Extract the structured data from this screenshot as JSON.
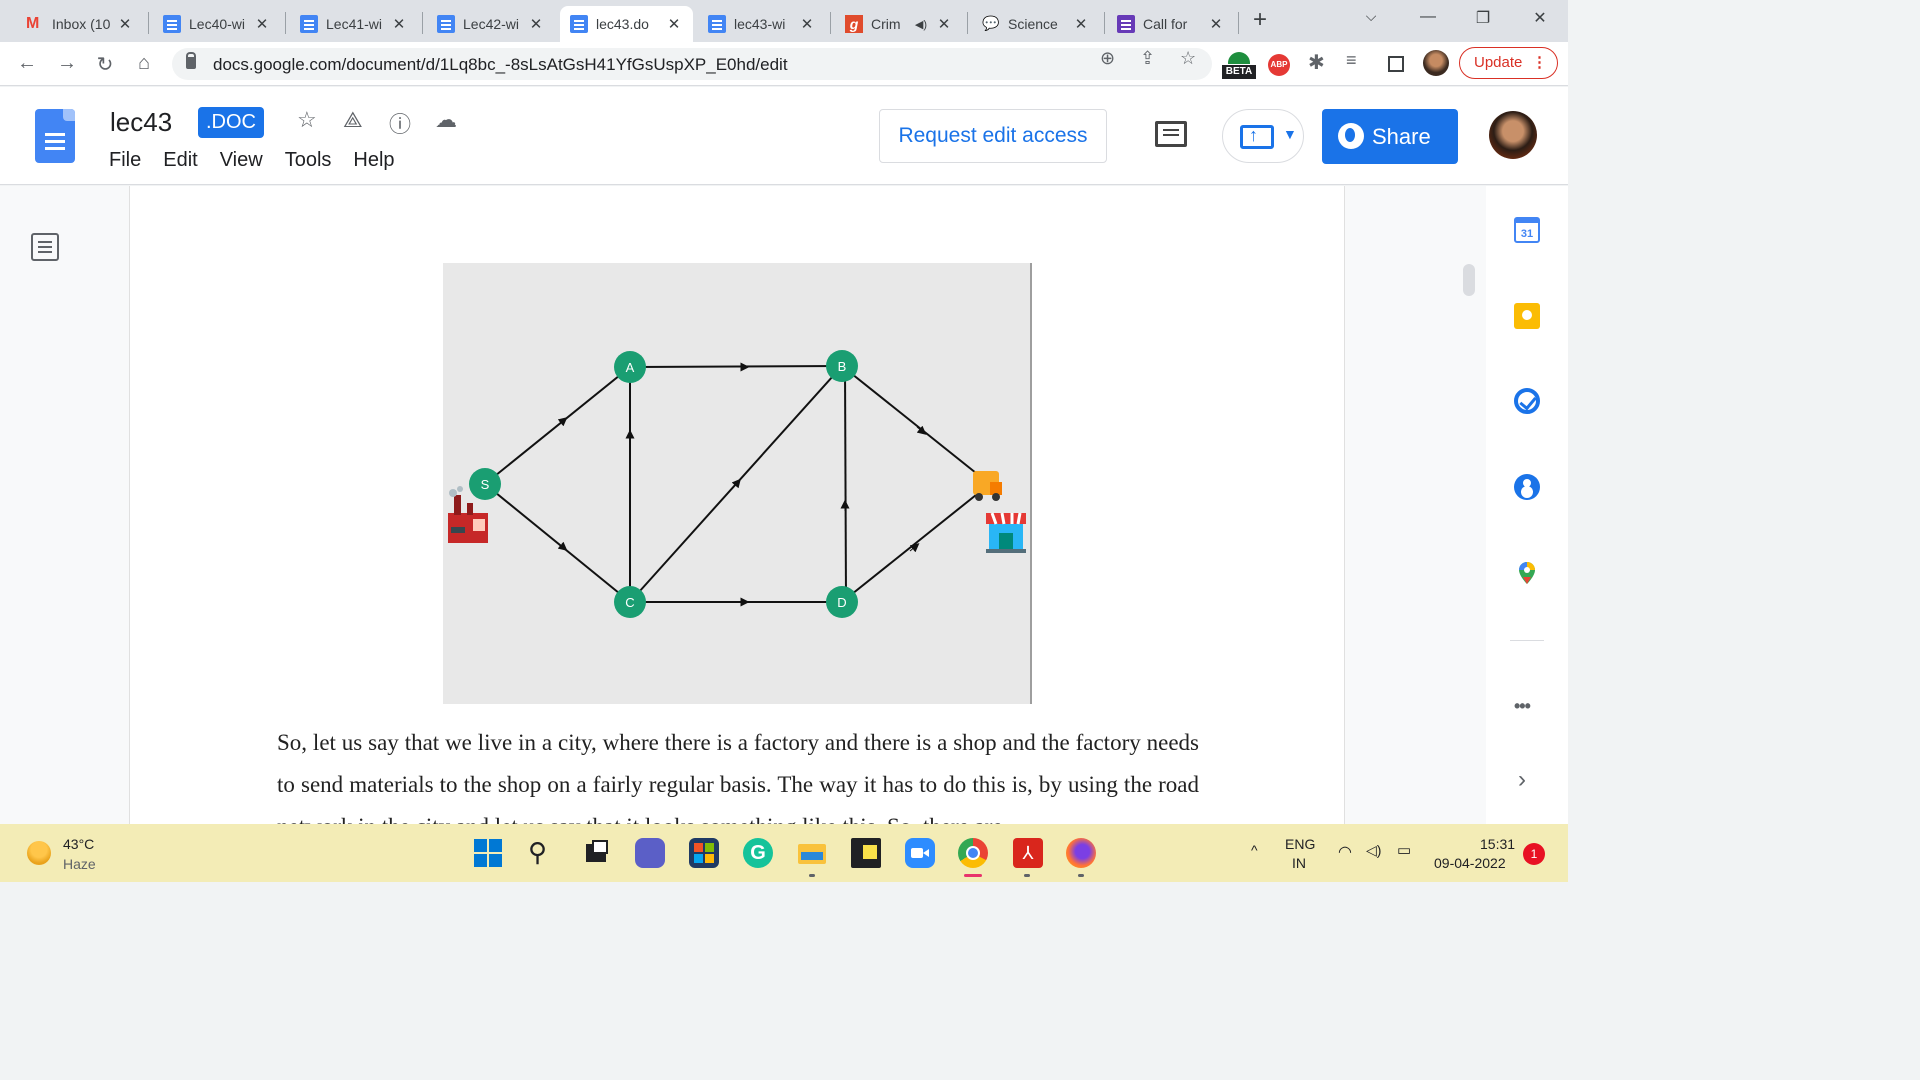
{
  "browser": {
    "tabs": [
      {
        "label": "Inbox (10",
        "icon": "gmail-icon",
        "active": false
      },
      {
        "label": "Lec40-wi",
        "icon": "google-docs-icon",
        "active": false
      },
      {
        "label": "Lec41-wi",
        "icon": "google-docs-icon",
        "active": false
      },
      {
        "label": "Lec42-wi",
        "icon": "google-docs-icon",
        "active": false
      },
      {
        "label": "lec43.do",
        "icon": "google-docs-icon",
        "active": true
      },
      {
        "label": "lec43-wi",
        "icon": "google-docs-icon",
        "active": false
      },
      {
        "label": "Crim",
        "icon": "grammarly-icon",
        "active": false,
        "audio": true
      },
      {
        "label": "Science",
        "icon": "speech-bubble-icon",
        "active": false
      },
      {
        "label": "Call for",
        "icon": "google-forms-icon",
        "active": false
      }
    ],
    "new_tab_glyph": "+",
    "url": "docs.google.com/document/d/1Lq8bc_-8sLsAtGsH41YfGsUspXP_E0hd/edit",
    "beta_label": "BETA",
    "abp_label": "ABP",
    "update_label": "Update",
    "close_glyph": "✕"
  },
  "doc": {
    "title": "lec43",
    "badge": ".DOC",
    "menu": [
      "File",
      "Edit",
      "View",
      "Tools",
      "Help"
    ],
    "request_edit": "Request edit access",
    "share": "Share",
    "paragraph": "So, let us say that we live in a city, where there is a factory and there is a shop and the factory needs to send materials to the shop on a fairly regular basis. The way it has to do this is, by using the road network in the city and let us say that it looks something like this. So, there are"
  },
  "diagram": {
    "background": "#e8e8e8",
    "node_color": "#1a9e72",
    "nodes": [
      "S",
      "A",
      "B",
      "C",
      "D"
    ],
    "edges": [
      [
        "S",
        "A"
      ],
      [
        "S",
        "C"
      ],
      [
        "A",
        "B"
      ],
      [
        "C",
        "A"
      ],
      [
        "C",
        "B"
      ],
      [
        "C",
        "D"
      ],
      [
        "D",
        "B"
      ],
      [
        "B",
        "T"
      ],
      [
        "D",
        "T"
      ]
    ]
  },
  "side_panel": {
    "calendar_day": "31",
    "more_glyph": "•••",
    "expand_glyph": "›"
  },
  "taskbar": {
    "temperature": "43°C",
    "weather": "Haze",
    "language": "ENG",
    "region": "IN",
    "time": "15:31",
    "date": "09-04-2022",
    "notifications": "1"
  }
}
